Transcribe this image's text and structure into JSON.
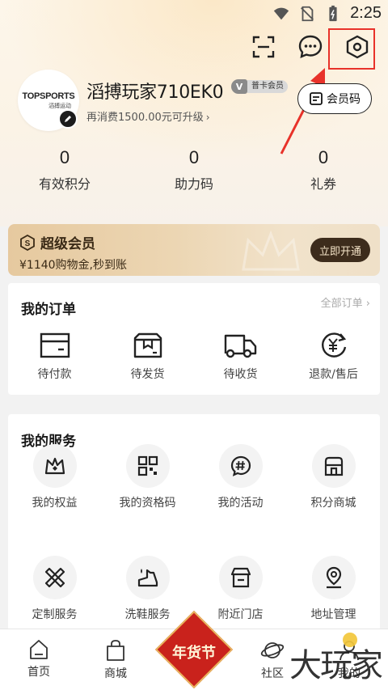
{
  "status_bar": {
    "time": "2:25"
  },
  "profile": {
    "avatar_brand": "TOPSPORTS",
    "avatar_brand_sub": "滔搏运动",
    "username": "滔搏玩家710EK0",
    "member_badge_letter": "V",
    "member_level": "普卡会员",
    "upgrade_hint": "再消费1500.00元可升级",
    "member_code_label": "会员码"
  },
  "stats": [
    {
      "value": "0",
      "label": "有效积分"
    },
    {
      "value": "0",
      "label": "助力码"
    },
    {
      "value": "0",
      "label": "礼券"
    }
  ],
  "super_member": {
    "title": "超级会员",
    "subtitle": "¥1140购物金,秒到账",
    "button": "立即开通"
  },
  "orders": {
    "title": "我的订单",
    "all_link": "全部订单 ›",
    "items": [
      {
        "label": "待付款",
        "icon": "wallet-icon"
      },
      {
        "label": "待发货",
        "icon": "package-icon"
      },
      {
        "label": "待收货",
        "icon": "truck-icon"
      },
      {
        "label": "退款/售后",
        "icon": "refund-icon"
      }
    ]
  },
  "services": {
    "title": "我的服务",
    "items": [
      {
        "label": "我的权益",
        "icon": "crown-icon"
      },
      {
        "label": "我的资格码",
        "icon": "qr-code-icon"
      },
      {
        "label": "我的活动",
        "icon": "hashtag-icon"
      },
      {
        "label": "积分商城",
        "icon": "store-icon"
      },
      {
        "label": "定制服务",
        "icon": "customize-icon"
      },
      {
        "label": "洗鞋服务",
        "icon": "shoe-clean-icon"
      },
      {
        "label": "附近门店",
        "icon": "shop-icon"
      },
      {
        "label": "地址管理",
        "icon": "location-icon"
      }
    ]
  },
  "bottom_nav": {
    "home": "首页",
    "mall": "商城",
    "festival": "年货节",
    "community": "社区",
    "mine": "我的"
  },
  "watermark": "大玩家",
  "colors": {
    "accent_red": "#e8322a",
    "banner_dark": "#3d2c1c",
    "festival_red": "#c9221c"
  }
}
